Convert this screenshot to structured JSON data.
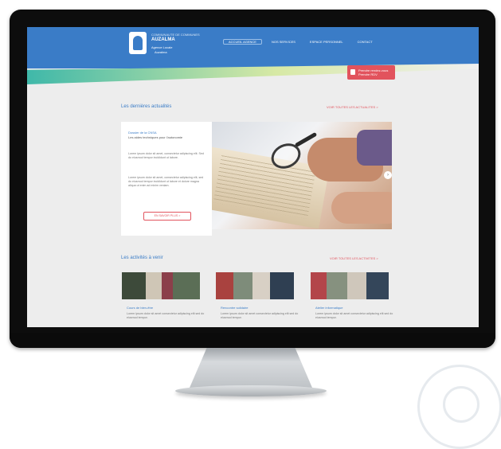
{
  "header": {
    "logo_line1": "COMMUNAUTE DE COMMUNES",
    "logo_line2": "AUZALMA",
    "logo_line3": "Agence Locale",
    "logo_line4": "Auzalma",
    "nav_items": [
      {
        "label": "ACCUEIL AGENCE",
        "active": true
      },
      {
        "label": "NOS SERVICES",
        "active": false
      },
      {
        "label": "ESPACE PERSONNEL",
        "active": false
      },
      {
        "label": "CONTACT",
        "active": false
      }
    ],
    "cta_line1": "Prendre rendez-vous",
    "cta_line2": "Prendre RDV"
  },
  "actualites": {
    "title": "Les dernières actualités",
    "link": "VOIR TOUTES LES ACTUALITES  >",
    "card": {
      "kicker": "Dossier de la CNSA",
      "subtitle": "Les aides techniques pour l'autonomie",
      "paragraph1": "Lorem ipsum dolor sit amet, consectetur adipiscing elit. Sed do eiusmod tempor incididunt ut labore.",
      "paragraph2": "Lorem ipsum dolor sit amet, consectetur adipiscing elit, sed do eiusmod tempor incididunt ut labore et dolore magna aliqua ut enim ad minim veniam.",
      "button": "EN SAVOIR PLUS  >"
    },
    "arrow": "›"
  },
  "activites": {
    "title": "Les activités à venir",
    "link": "VOIR TOUTES LES ACTIVITES  >",
    "items": [
      {
        "title": "Cours de bien-être",
        "text": "Lorem ipsum dolor sit amet consectetur adipiscing elit sed do eiusmod tempor."
      },
      {
        "title": "Rencontre solidaire",
        "text": "Lorem ipsum dolor sit amet consectetur adipiscing elit sed do eiusmod tempor."
      },
      {
        "title": "Atelier informatique",
        "text": "Lorem ipsum dolor sit amet consectetur adipiscing elit sed do eiusmod tempor."
      }
    ]
  },
  "colors": {
    "brand_blue": "#3a7cc7",
    "accent_red": "#e2535d",
    "teal": "#3fb8a9"
  }
}
